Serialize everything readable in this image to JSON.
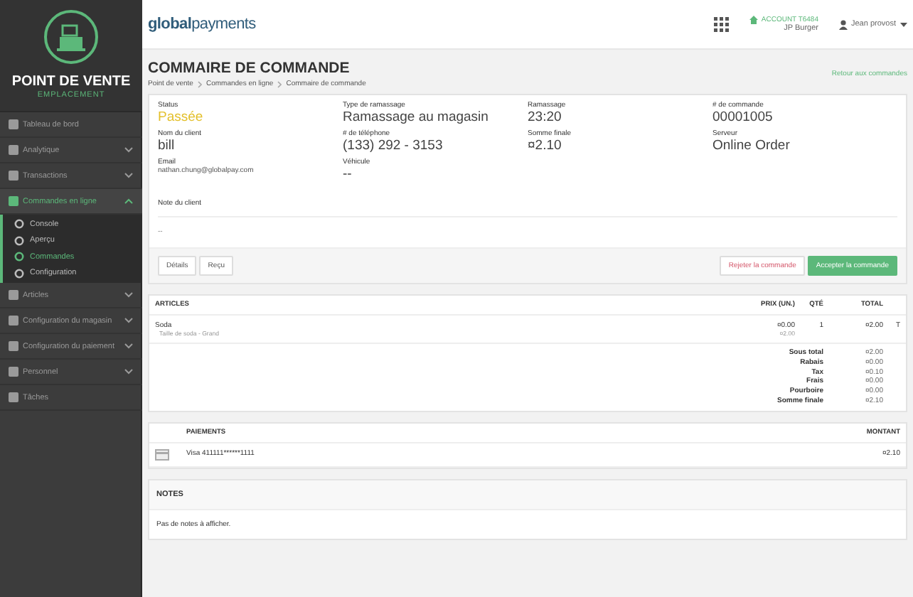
{
  "sidebar": {
    "title": "POINT DE VENTE",
    "subtitle": "EMPLACEMENT",
    "items": [
      {
        "label": "Tableau de bord",
        "kind": "link",
        "expanded": false
      },
      {
        "label": "Analytique",
        "kind": "group",
        "expanded": false
      },
      {
        "label": "Transactions",
        "kind": "group",
        "expanded": false
      },
      {
        "label": "Commandes en ligne",
        "kind": "group",
        "expanded": true,
        "children": [
          {
            "label": "Console",
            "selected": false
          },
          {
            "label": "Aperçu",
            "selected": false
          },
          {
            "label": "Commandes",
            "selected": true
          },
          {
            "label": "Configuration",
            "selected": false
          }
        ]
      },
      {
        "label": "Articles",
        "kind": "group",
        "expanded": false
      },
      {
        "label": "Configuration du magasin",
        "kind": "group",
        "expanded": false
      },
      {
        "label": "Configuration du paiement",
        "kind": "group",
        "expanded": false
      },
      {
        "label": "Personnel",
        "kind": "group",
        "expanded": false
      },
      {
        "label": "Tâches",
        "kind": "link",
        "expanded": false
      }
    ]
  },
  "topbar": {
    "logo": "**global**payments",
    "account_label": "ACCOUNT T6484",
    "account_name": "JP Burger",
    "user": "Jean provost"
  },
  "header": {
    "title": "COMMAIRE DE COMMANDE",
    "breadcrumbs": [
      "Point de vente",
      "Commandes en ligne",
      "Commaire de commande"
    ],
    "back_link": "Retour aux commandes"
  },
  "details": {
    "fields": [
      {
        "label": "Status",
        "value": "Passée",
        "kind": "status"
      },
      {
        "label": "Type de ramassage",
        "value": "Ramassage au magasin",
        "kind": "large"
      },
      {
        "label": "Ramassage",
        "value": "23:20",
        "kind": "large"
      },
      {
        "label": "# de commande",
        "value": "00001005",
        "kind": "large"
      },
      {
        "label": "Nom du client",
        "value": "bill",
        "kind": "large"
      },
      {
        "label": "# de téléphone",
        "value": "(133) 292 - 3153",
        "kind": "large"
      },
      {
        "label": "Somme finale",
        "value": "¤2.10",
        "kind": "large"
      },
      {
        "label": "Serveur",
        "value": "Online Order",
        "kind": "large"
      },
      {
        "label": "Email",
        "value": "nathan.chung@globalpay.com",
        "kind": "small"
      },
      {
        "label": "Véhicule",
        "value": "--",
        "kind": "large"
      }
    ],
    "note_label": "Note du client",
    "note": "--",
    "buttons": [
      {
        "label": "Détails",
        "kind": "plain"
      },
      {
        "label": "Reçu",
        "kind": "plain"
      },
      {
        "label": "Rejeter la commande",
        "kind": "danger"
      },
      {
        "label": "Accepter la commande",
        "kind": "primary"
      }
    ]
  },
  "articles": {
    "columns": [
      "ARTICLES",
      "PRIX (UN.)",
      "QTÉ",
      "TOTAL"
    ],
    "rows": [
      {
        "name": "Soda",
        "option": "Taille de soda - Grand",
        "price": "¤0.00",
        "price_extra": "¤2.00",
        "qty": "1",
        "total": "¤2.00",
        "tax_mark": "T"
      }
    ],
    "summary": [
      {
        "label": "Sous total",
        "value": "¤2.00"
      },
      {
        "label": "Rabais",
        "value": "¤0.00"
      },
      {
        "label": "Tax",
        "value": "¤0.10"
      },
      {
        "label": "Frais",
        "value": "¤0.00"
      },
      {
        "label": "Pourboire",
        "value": "¤0.00"
      },
      {
        "label": "Somme finale",
        "value": "¤2.10"
      }
    ]
  },
  "payments": {
    "columns": [
      "PAIEMENTS",
      "MONTANT"
    ],
    "rows": [
      {
        "method": "Visa 411111******1111",
        "amount": "¤2.10"
      }
    ]
  },
  "notes": {
    "title": "NOTES",
    "text": "Pas de notes à afficher."
  }
}
